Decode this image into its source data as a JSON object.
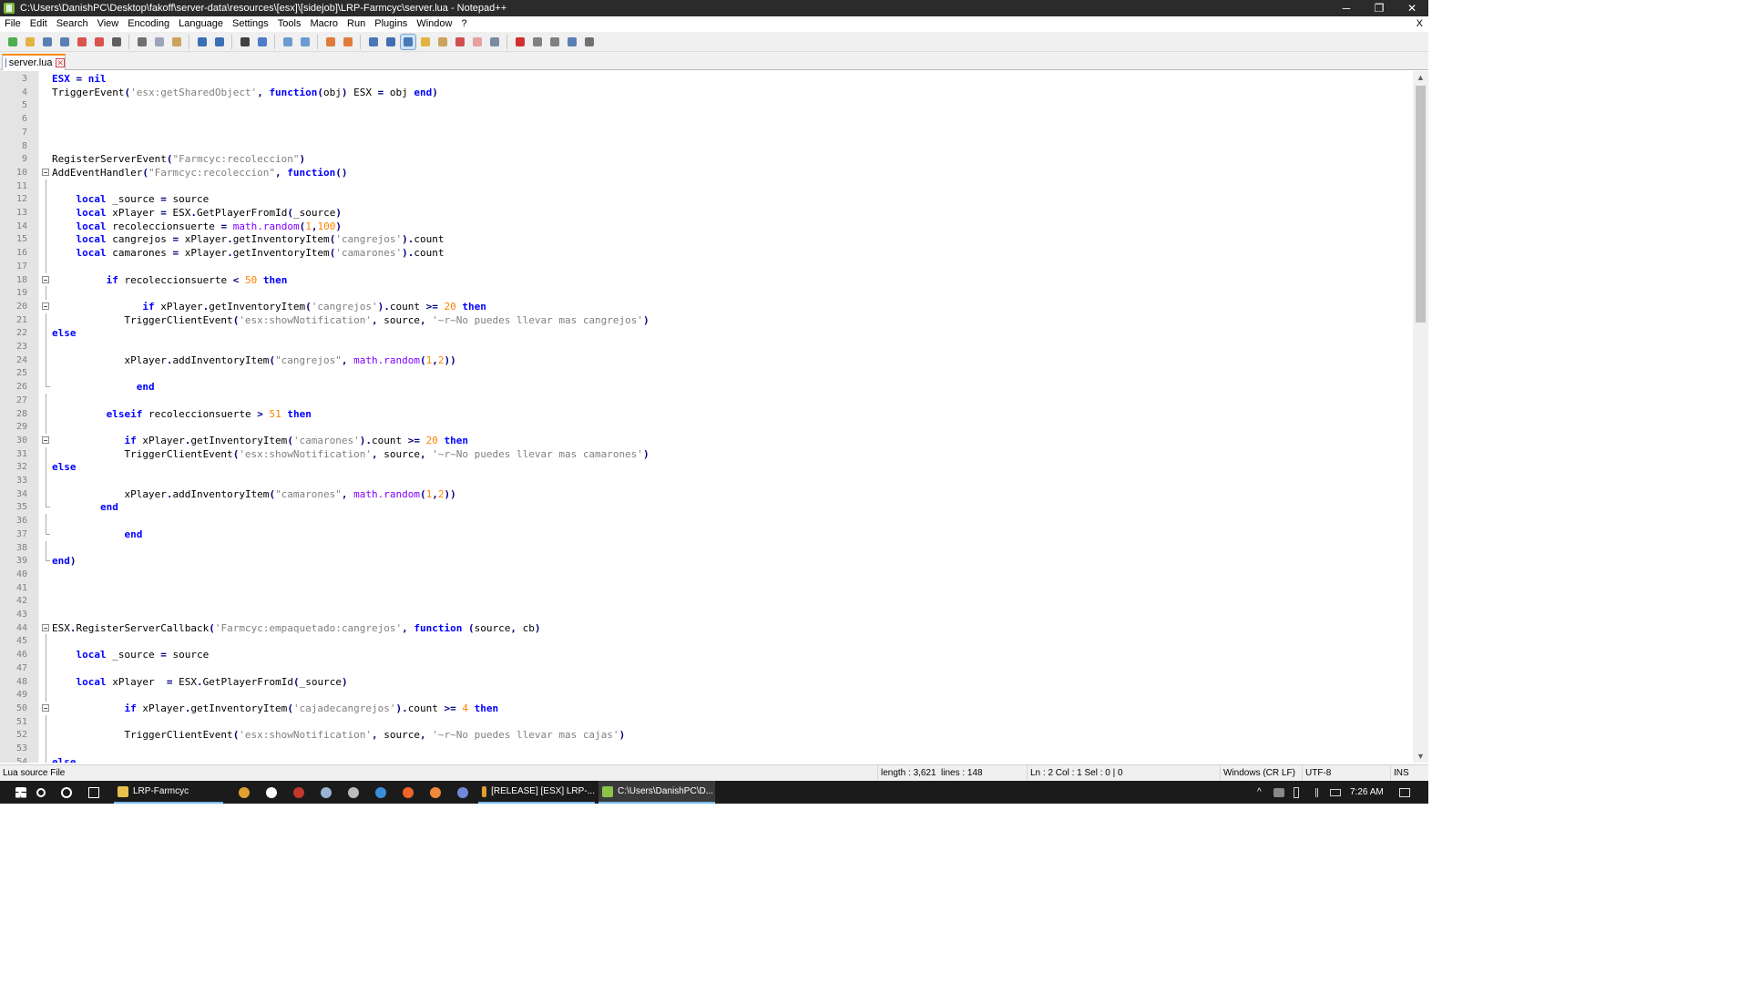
{
  "window": {
    "title": "C:\\Users\\DanishPC\\Desktop\\fakoff\\server-data\\resources\\[esx]\\[sidejob]\\LRP-Farmcyc\\server.lua - Notepad++",
    "minimize_glyph": "─",
    "maximize_glyph": "❐",
    "close_glyph": "✕"
  },
  "menu": {
    "items": [
      "File",
      "Edit",
      "Search",
      "View",
      "Encoding",
      "Language",
      "Settings",
      "Tools",
      "Macro",
      "Run",
      "Plugins",
      "Window",
      "?"
    ],
    "close_glyph": "X"
  },
  "toolbar": {
    "buttons": [
      {
        "icon": "new-file-icon",
        "color": "#4caf50"
      },
      {
        "icon": "open-file-icon",
        "color": "#e3b341"
      },
      {
        "icon": "save-icon",
        "color": "#5a7fb5"
      },
      {
        "icon": "save-all-icon",
        "color": "#5a7fb5"
      },
      {
        "icon": "close-icon",
        "color": "#d9534f"
      },
      {
        "icon": "close-all-icon",
        "color": "#d9534f"
      },
      {
        "icon": "print-icon",
        "color": "#606060"
      },
      {
        "sep": true
      },
      {
        "icon": "cut-icon",
        "color": "#707070"
      },
      {
        "icon": "copy-icon",
        "color": "#9aa6b8"
      },
      {
        "icon": "paste-icon",
        "color": "#c9a45c"
      },
      {
        "sep": true
      },
      {
        "icon": "undo-icon",
        "color": "#3b6fb6"
      },
      {
        "icon": "redo-icon",
        "color": "#3b6fb6"
      },
      {
        "sep": true
      },
      {
        "icon": "find-icon",
        "color": "#404040"
      },
      {
        "icon": "replace-icon",
        "color": "#4d7cc9"
      },
      {
        "sep": true
      },
      {
        "icon": "zoom-in-icon",
        "color": "#6b9ad1"
      },
      {
        "icon": "zoom-out-icon",
        "color": "#6b9ad1"
      },
      {
        "sep": true
      },
      {
        "icon": "sync-vertical-icon",
        "color": "#e07b39"
      },
      {
        "icon": "sync-horizontal-icon",
        "color": "#e07b39"
      },
      {
        "sep": true
      },
      {
        "icon": "word-wrap-icon",
        "color": "#4a78b8"
      },
      {
        "icon": "show-all-chars-icon",
        "color": "#3f6fb0"
      },
      {
        "icon": "indent-guide-icon",
        "color": "#4a78b8",
        "active": true
      },
      {
        "icon": "udl-icon",
        "color": "#e3b341"
      },
      {
        "icon": "doc-map-icon",
        "color": "#c9a45c"
      },
      {
        "icon": "function-list-icon",
        "color": "#d05050"
      },
      {
        "icon": "folder-workspace-icon",
        "color": "#e8a0a0"
      },
      {
        "icon": "monitoring-icon",
        "color": "#7a8aa0"
      },
      {
        "sep": true
      },
      {
        "icon": "record-macro-icon",
        "color": "#d32f2f"
      },
      {
        "icon": "stop-record-icon",
        "color": "#808080"
      },
      {
        "icon": "play-macro-icon",
        "color": "#808080"
      },
      {
        "icon": "run-macro-multiple-icon",
        "color": "#5a7fb5"
      },
      {
        "icon": "save-macro-icon",
        "color": "#707070"
      }
    ]
  },
  "tab": {
    "label": "server.lua",
    "close_glyph": "✕"
  },
  "editor": {
    "lines": [
      {
        "n": "3",
        "fold": "",
        "code": "<span class='k'>ESX</span> <span class='o'>=</span> <span class='k'>nil</span>"
      },
      {
        "n": "4",
        "fold": "",
        "code": "TriggerEvent<span class='o'>(</span><span class='s'>'esx:getSharedObject'</span><span class='o'>,</span> <span class='k'>function</span><span class='o'>(</span>obj<span class='o'>)</span> ESX <span class='o'>=</span> obj <span class='k'>end</span><span class='o'>)</span>"
      },
      {
        "n": "5",
        "fold": "",
        "code": ""
      },
      {
        "n": "6",
        "fold": "",
        "code": ""
      },
      {
        "n": "7",
        "fold": "",
        "code": ""
      },
      {
        "n": "8",
        "fold": "",
        "code": ""
      },
      {
        "n": "9",
        "fold": "",
        "code": "RegisterServerEvent<span class='o'>(</span><span class='s'>\"Farmcyc:recoleccion\"</span><span class='o'>)</span>"
      },
      {
        "n": "10",
        "fold": "start",
        "code": "AddEventHandler<span class='o'>(</span><span class='s'>\"Farmcyc:recoleccion\"</span><span class='o'>,</span> <span class='k'>function</span><span class='o'>()</span>"
      },
      {
        "n": "11",
        "fold": "line",
        "code": ""
      },
      {
        "n": "12",
        "fold": "line",
        "code": "    <span class='k'>local</span> _source <span class='o'>=</span> source"
      },
      {
        "n": "13",
        "fold": "line",
        "code": "    <span class='k'>local</span> xPlayer <span class='o'>=</span> ESX<span class='o'>.</span>GetPlayerFromId<span class='o'>(</span>_source<span class='o'>)</span>"
      },
      {
        "n": "14",
        "fold": "line",
        "code": "    <span class='k'>local</span> recoleccionsuerte <span class='o'>=</span> <span class='m'>math.random</span><span class='o'>(</span><span class='n'>1</span><span class='o'>,</span><span class='n'>100</span><span class='o'>)</span>"
      },
      {
        "n": "15",
        "fold": "line",
        "code": "    <span class='k'>local</span> cangrejos <span class='o'>=</span> xPlayer<span class='o'>.</span>getInventoryItem<span class='o'>(</span><span class='s'>'cangrejos'</span><span class='o'>).</span>count"
      },
      {
        "n": "16",
        "fold": "line",
        "code": "    <span class='k'>local</span> camarones <span class='o'>=</span> xPlayer<span class='o'>.</span>getInventoryItem<span class='o'>(</span><span class='s'>'camarones'</span><span class='o'>).</span>count"
      },
      {
        "n": "17",
        "fold": "line",
        "code": ""
      },
      {
        "n": "18",
        "fold": "start",
        "code": "         <span class='k'>if</span> recoleccionsuerte <span class='o'>&lt;</span> <span class='n'>50</span> <span class='k'>then</span>"
      },
      {
        "n": "19",
        "fold": "line",
        "code": ""
      },
      {
        "n": "20",
        "fold": "start",
        "code": "               <span class='k'>if</span> xPlayer<span class='o'>.</span>getInventoryItem<span class='o'>(</span><span class='s'>'cangrejos'</span><span class='o'>).</span>count <span class='o'>&gt;=</span> <span class='n'>20</span> <span class='k'>then</span>"
      },
      {
        "n": "21",
        "fold": "line",
        "code": "            TriggerClientEvent<span class='o'>(</span><span class='s'>'esx:showNotification'</span><span class='o'>,</span> source<span class='o'>,</span> <span class='s'>'~r~No puedes llevar mas cangrejos'</span><span class='o'>)</span>"
      },
      {
        "n": "22",
        "fold": "line",
        "code": "<span class='k'>else</span>"
      },
      {
        "n": "23",
        "fold": "line",
        "code": ""
      },
      {
        "n": "24",
        "fold": "line",
        "code": "            xPlayer<span class='o'>.</span>addInventoryItem<span class='o'>(</span><span class='s'>\"cangrejos\"</span><span class='o'>,</span> <span class='m'>math.random</span><span class='o'>(</span><span class='n'>1</span><span class='o'>,</span><span class='n'>2</span><span class='o'>))</span>"
      },
      {
        "n": "25",
        "fold": "line",
        "code": ""
      },
      {
        "n": "26",
        "fold": "end",
        "code": "              <span class='k'>end</span>"
      },
      {
        "n": "27",
        "fold": "line",
        "code": ""
      },
      {
        "n": "28",
        "fold": "line",
        "code": "         <span class='k'>elseif</span> recoleccionsuerte <span class='o'>&gt;</span> <span class='n'>51</span> <span class='k'>then</span>"
      },
      {
        "n": "29",
        "fold": "line",
        "code": ""
      },
      {
        "n": "30",
        "fold": "start",
        "code": "            <span class='k'>if</span> xPlayer<span class='o'>.</span>getInventoryItem<span class='o'>(</span><span class='s'>'camarones'</span><span class='o'>).</span>count <span class='o'>&gt;=</span> <span class='n'>20</span> <span class='k'>then</span>"
      },
      {
        "n": "31",
        "fold": "line",
        "code": "            TriggerClientEvent<span class='o'>(</span><span class='s'>'esx:showNotification'</span><span class='o'>,</span> source<span class='o'>,</span> <span class='s'>'~r~No puedes llevar mas camarones'</span><span class='o'>)</span>"
      },
      {
        "n": "32",
        "fold": "line",
        "code": "<span class='k'>else</span>"
      },
      {
        "n": "33",
        "fold": "line",
        "code": ""
      },
      {
        "n": "34",
        "fold": "line",
        "code": "            xPlayer<span class='o'>.</span>addInventoryItem<span class='o'>(</span><span class='s'>\"camarones\"</span><span class='o'>,</span> <span class='m'>math.random</span><span class='o'>(</span><span class='n'>1</span><span class='o'>,</span><span class='n'>2</span><span class='o'>))</span>"
      },
      {
        "n": "35",
        "fold": "end",
        "code": "        <span class='k'>end</span>"
      },
      {
        "n": "36",
        "fold": "line",
        "code": ""
      },
      {
        "n": "37",
        "fold": "end",
        "code": "            <span class='k'>end</span>"
      },
      {
        "n": "38",
        "fold": "line",
        "code": ""
      },
      {
        "n": "39",
        "fold": "end",
        "code": "<span class='k'>end</span><span class='o'>)</span>"
      },
      {
        "n": "40",
        "fold": "",
        "code": ""
      },
      {
        "n": "41",
        "fold": "",
        "code": ""
      },
      {
        "n": "42",
        "fold": "",
        "code": ""
      },
      {
        "n": "43",
        "fold": "",
        "code": ""
      },
      {
        "n": "44",
        "fold": "start",
        "code": "ESX<span class='o'>.</span>RegisterServerCallback<span class='o'>(</span><span class='s'>'Farmcyc:empaquetado:cangrejos'</span><span class='o'>,</span> <span class='k'>function</span> <span class='o'>(</span>source<span class='o'>,</span> cb<span class='o'>)</span>"
      },
      {
        "n": "45",
        "fold": "line",
        "code": ""
      },
      {
        "n": "46",
        "fold": "line",
        "code": "    <span class='k'>local</span> _source <span class='o'>=</span> source"
      },
      {
        "n": "47",
        "fold": "line",
        "code": ""
      },
      {
        "n": "48",
        "fold": "line",
        "code": "    <span class='k'>local</span> xPlayer  <span class='o'>=</span> ESX<span class='o'>.</span>GetPlayerFromId<span class='o'>(</span>_source<span class='o'>)</span>"
      },
      {
        "n": "49",
        "fold": "line",
        "code": ""
      },
      {
        "n": "50",
        "fold": "start",
        "code": "            <span class='k'>if</span> xPlayer<span class='o'>.</span>getInventoryItem<span class='o'>(</span><span class='s'>'cajadecangrejos'</span><span class='o'>).</span>count <span class='o'>&gt;=</span> <span class='n'>4</span> <span class='k'>then</span>"
      },
      {
        "n": "51",
        "fold": "line",
        "code": ""
      },
      {
        "n": "52",
        "fold": "line",
        "code": "            TriggerClientEvent<span class='o'>(</span><span class='s'>'esx:showNotification'</span><span class='o'>,</span> source<span class='o'>,</span> <span class='s'>'~r~No puedes llevar mas cajas'</span><span class='o'>)</span>"
      },
      {
        "n": "53",
        "fold": "line",
        "code": ""
      },
      {
        "n": "54",
        "fold": "line",
        "code": "<span class='k'>else</span>"
      }
    ],
    "colors": {
      "keyword": "#0000ff",
      "string": "#808080",
      "number": "#ff8000",
      "library": "#8000ff",
      "operator": "#000080"
    },
    "scroll_up_glyph": "▲",
    "scroll_down_glyph": "▼"
  },
  "status": {
    "filetype": "Lua source File",
    "length": "length : 3,621",
    "lines": "lines : 148",
    "position": "Ln : 2    Col : 1    Sel : 0 | 0",
    "eol": "Windows (CR LF)",
    "encoding": "UTF-8",
    "mode": "INS"
  },
  "taskbar": {
    "pinned": [
      {
        "icon": "windows-start-icon",
        "color": "#ffffff"
      },
      {
        "icon": "search-icon",
        "color": "#ffffff"
      },
      {
        "icon": "cortana-icon",
        "color": "#ffffff"
      },
      {
        "icon": "task-view-icon",
        "color": "#ffffff"
      }
    ],
    "apps": [
      {
        "icon": "folder-icon",
        "label": "LRP-Farmcyc",
        "color": "#e8c14a"
      },
      {
        "icon": "chrome-icon",
        "label": "",
        "color": "#e0a030"
      },
      {
        "icon": "store-icon",
        "label": "",
        "color": "#ffffff"
      },
      {
        "icon": "game-icon",
        "label": "",
        "color": "#c0392b"
      },
      {
        "icon": "steam-icon",
        "label": "",
        "color": "#9ab3d1"
      },
      {
        "icon": "app-icon",
        "label": "",
        "color": "#bbbbbb"
      },
      {
        "icon": "teamspeak-icon",
        "label": "",
        "color": "#3a8fd9"
      },
      {
        "icon": "origin-icon",
        "label": "",
        "color": "#f0642a"
      },
      {
        "icon": "browser-icon",
        "label": "",
        "color": "#f08a3a"
      },
      {
        "icon": "discord-icon",
        "label": "",
        "color": "#7289da"
      },
      {
        "icon": "chrome-icon",
        "label": "[RELEASE] [ESX] LRP-...",
        "color": "#e0a030"
      },
      {
        "icon": "notepadpp-icon",
        "label": "C:\\Users\\DanishPC\\D...",
        "color": "#8bc34a"
      }
    ],
    "time": "7:26 AM",
    "tray_caret": "^"
  }
}
